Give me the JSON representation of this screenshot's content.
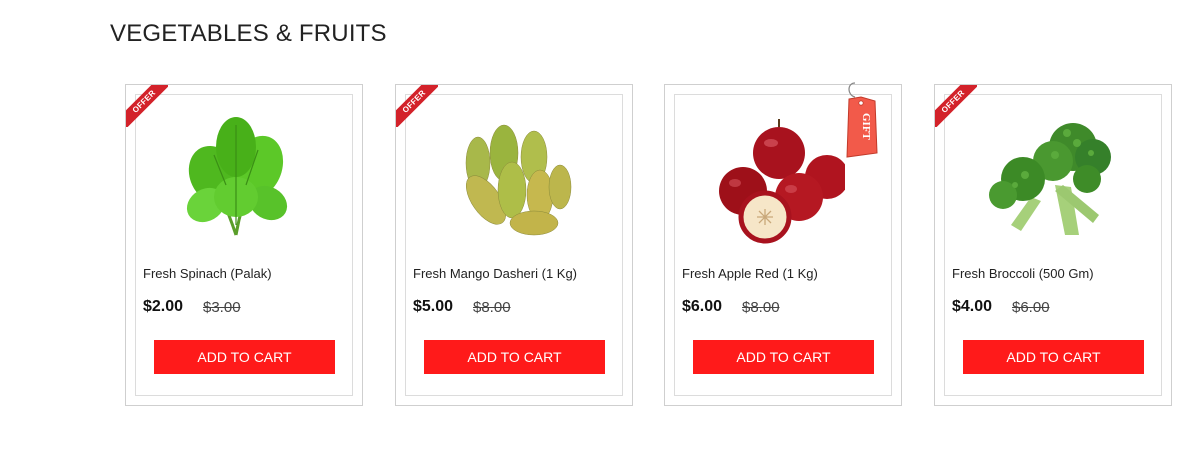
{
  "section": {
    "title": "VEGETABLES & FRUITS"
  },
  "products": [
    {
      "name": "Fresh Spinach (Palak)",
      "price": "$2.00",
      "old_price": "$3.00",
      "badge": "OFFER",
      "button_label": "ADD TO CART",
      "image_icon": "spinach-image"
    },
    {
      "name": "Fresh Mango Dasheri (1 Kg)",
      "price": "$5.00",
      "old_price": "$8.00",
      "badge": "OFFER",
      "button_label": "ADD TO CART",
      "image_icon": "mango-image"
    },
    {
      "name": "Fresh Apple Red (1 Kg)",
      "price": "$6.00",
      "old_price": "$8.00",
      "badge": "GIFT",
      "button_label": "ADD TO CART",
      "image_icon": "apple-image"
    },
    {
      "name": "Fresh Broccoli (500 Gm)",
      "price": "$4.00",
      "old_price": "$6.00",
      "badge": "OFFER",
      "button_label": "ADD TO CART",
      "image_icon": "broccoli-image"
    }
  ],
  "colors": {
    "button": "#ff1a1a",
    "ribbon": "#d3222a",
    "border": "#cfcfcf"
  }
}
